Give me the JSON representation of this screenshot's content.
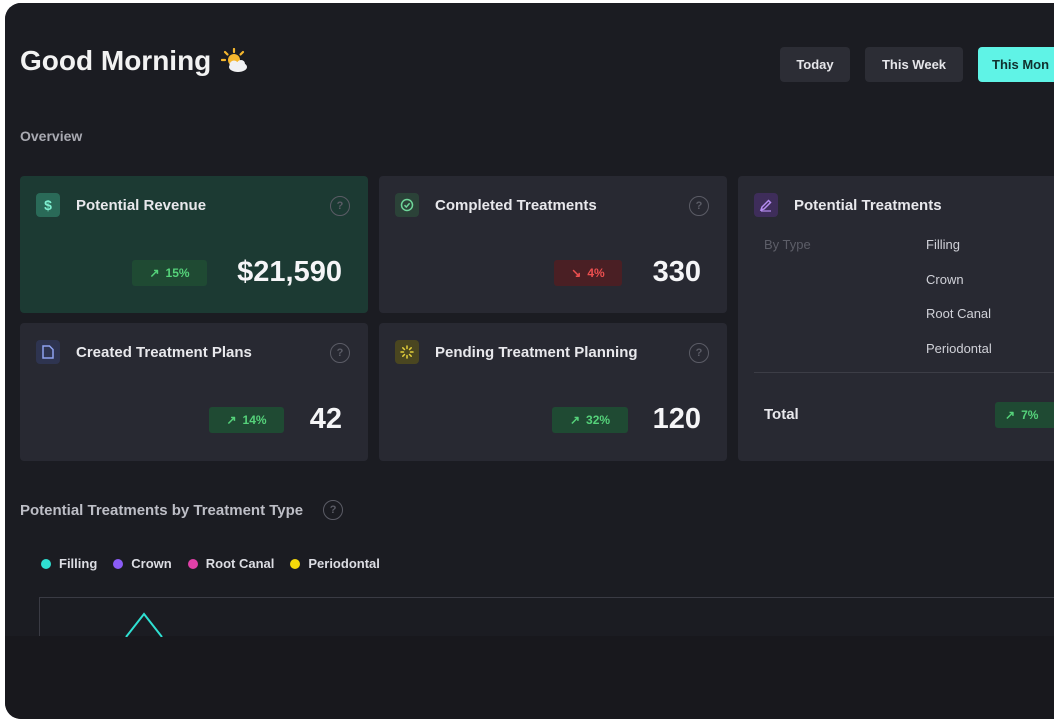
{
  "header": {
    "greeting": "Good Morning",
    "greeting_icon": "sun-behind-cloud-icon"
  },
  "period_buttons": [
    {
      "label": "Today",
      "active": false
    },
    {
      "label": "This Week",
      "active": false
    },
    {
      "label": "This Mon",
      "active": true
    }
  ],
  "overview": {
    "label": "Overview",
    "cards": {
      "revenue": {
        "title": "Potential Revenue",
        "icon": "dollar-icon",
        "trend": "15%",
        "trend_dir": "up",
        "value": "$21,590"
      },
      "completed": {
        "title": "Completed Treatments",
        "icon": "check-circle-icon",
        "trend": "4%",
        "trend_dir": "down",
        "value": "330"
      },
      "created": {
        "title": "Created Treatment Plans",
        "icon": "document-icon",
        "trend": "14%",
        "trend_dir": "up",
        "value": "42"
      },
      "pending": {
        "title": "Pending Treatment Planning",
        "icon": "loading-icon",
        "trend": "32%",
        "trend_dir": "up",
        "value": "120"
      }
    },
    "potential_treatments": {
      "title": "Potential Treatments",
      "icon": "pen-icon",
      "by_type_label": "By Type",
      "types": [
        "Filling",
        "Crown",
        "Root Canal",
        "Periodontal"
      ],
      "total_label": "Total",
      "total_trend": "7%",
      "total_trend_dir": "up"
    }
  },
  "chart_section": {
    "title": "Potential Treatments by Treatment Type",
    "legend": [
      {
        "name": "Filling",
        "color": "#2fe0d2"
      },
      {
        "name": "Crown",
        "color": "#8b5cf6"
      },
      {
        "name": "Root Canal",
        "color": "#e040a8"
      },
      {
        "name": "Periodontal",
        "color": "#f5d90a"
      }
    ]
  },
  "colors": {
    "accent": "#5ff3e6",
    "trend_up": "#55d27a",
    "trend_down": "#ec4f4f"
  }
}
